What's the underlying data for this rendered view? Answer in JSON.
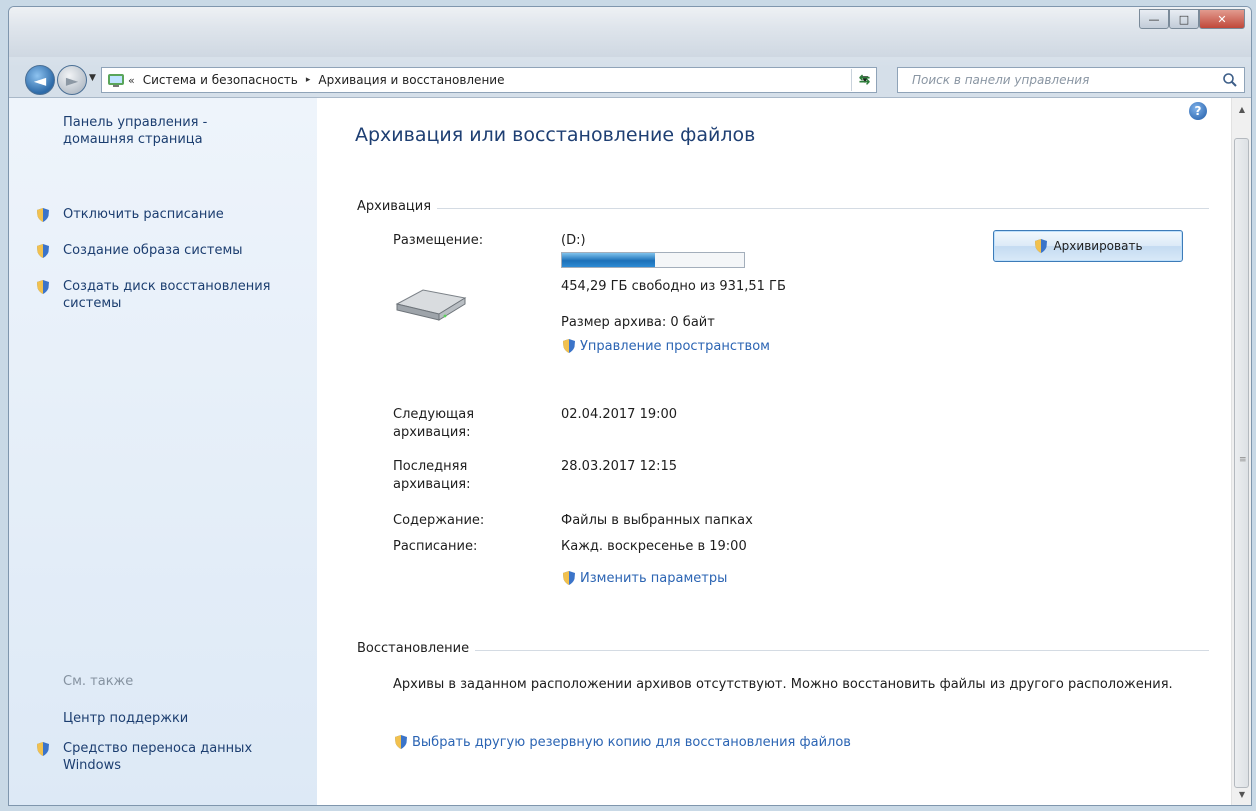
{
  "window": {
    "caption_buttons": {
      "minimize": "—",
      "maximize": "□",
      "close": "✕"
    }
  },
  "navbar": {
    "address_chevron": "«",
    "breadcrumbs": [
      "Система и безопасность",
      "Архивация и восстановление"
    ],
    "crumb_separator": "▸",
    "search_placeholder": "Поиск в панели управления"
  },
  "sidebar": {
    "home_link": "Панель управления - домашняя страница",
    "items": [
      {
        "label": "Отключить расписание"
      },
      {
        "label": "Создание образа системы"
      },
      {
        "label": "Создать диск восстановления системы"
      }
    ],
    "see_also_label": "См. также",
    "see_also_items": [
      {
        "label": "Центр поддержки"
      },
      {
        "label": "Средство переноса данных Windows"
      }
    ]
  },
  "main": {
    "title": "Архивация или восстановление файлов",
    "backup_section": {
      "label": "Архивация",
      "location_label": "Размещение:",
      "location_value": "(D:)",
      "disk_used_fraction": 0.512,
      "free_space_text": "454,29 ГБ свободно из 931,51 ГБ",
      "archive_size_text": "Размер архива: 0 байт",
      "manage_space_link": "Управление пространством",
      "backup_button": "Архивировать",
      "next_backup_label": "Следующая архивация:",
      "next_backup_value": "02.04.2017 19:00",
      "last_backup_label": "Последняя архивация:",
      "last_backup_value": "28.03.2017 12:15",
      "contents_label": "Содержание:",
      "contents_value": "Файлы в выбранных папках",
      "schedule_label": "Расписание:",
      "schedule_value": "Кажд. воскресенье в 19:00",
      "change_settings_link": "Изменить параметры"
    },
    "restore_section": {
      "label": "Восстановление",
      "message": "Архивы в заданном расположении архивов отсутствуют. Можно восстановить файлы из другого расположения.",
      "choose_backup_link": "Выбрать другую резервную копию для восстановления файлов"
    }
  }
}
